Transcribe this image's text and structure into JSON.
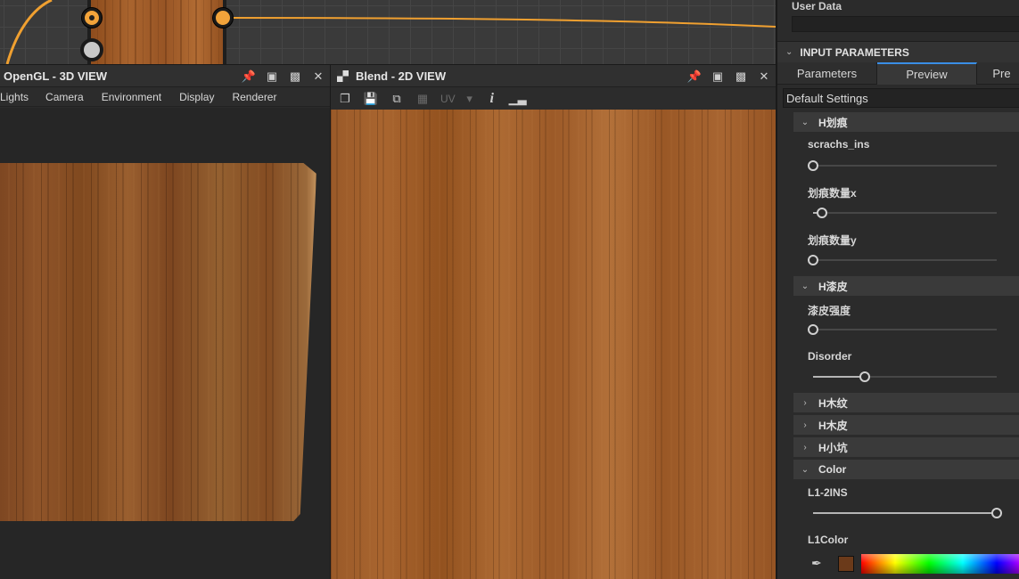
{
  "view3d": {
    "title": "OpenGL - 3D VIEW",
    "menu": [
      "Lights",
      "Camera",
      "Environment",
      "Display",
      "Renderer"
    ]
  },
  "view2d": {
    "title": "Blend - 2D VIEW",
    "toolbar_uv": "UV"
  },
  "right_panel": {
    "user_data_label": "User Data",
    "section_title": "INPUT PARAMETERS",
    "tabs": [
      "Parameters",
      "Preview",
      "Pre"
    ],
    "active_tab": "Preview",
    "preset": "Default Settings",
    "groups": {
      "scratch": "H划痕",
      "paint": "H漆皮",
      "grain": "H木纹",
      "bark": "H木皮",
      "pits": "H小坑",
      "color": "Color"
    },
    "params": {
      "scrachs_ins": {
        "label": "scrachs_ins",
        "value": 0.0
      },
      "scratch_count_x": {
        "label": "划痕数量x",
        "value": 0.05
      },
      "scratch_count_y": {
        "label": "划痕数量y",
        "value": 0.0
      },
      "paint_strength": {
        "label": "漆皮强度",
        "value": 0.0
      },
      "disorder": {
        "label": "Disorder",
        "value": 0.28
      },
      "l1_2ins": {
        "label": "L1-2INS",
        "value": 1.0
      },
      "l1color": {
        "label": "L1Color",
        "color": "#6b3a1a"
      }
    }
  },
  "colors": {
    "accent": "#3a8ee6",
    "port_orange": "#f2a33a",
    "wire_orange": "#f0a030"
  }
}
